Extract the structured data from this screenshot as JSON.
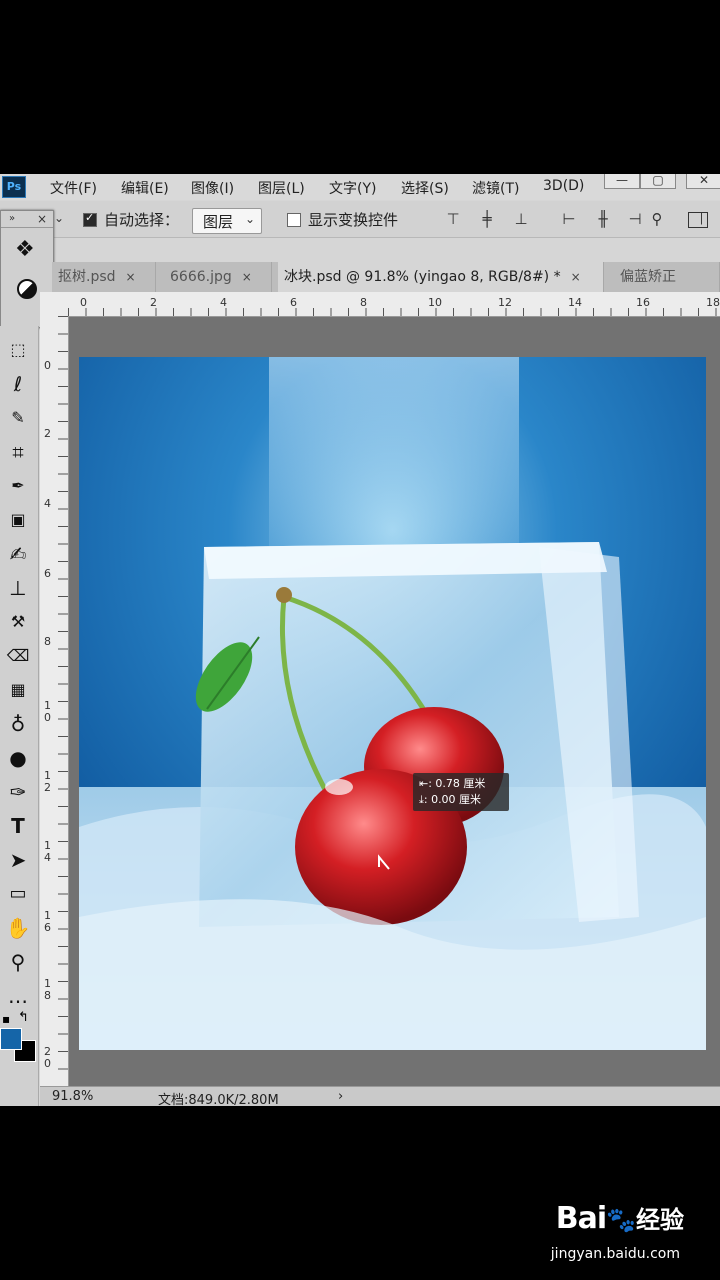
{
  "app": {
    "logo": "Ps",
    "menu": [
      "文件(F)",
      "编辑(E)",
      "图像(I)",
      "图层(L)",
      "文字(Y)",
      "选择(S)",
      "滤镜(T)",
      "3D(D)"
    ],
    "window_buttons": [
      "—",
      "▢",
      "✕"
    ]
  },
  "options": {
    "auto_select_label": "自动选择：",
    "auto_select_checked": true,
    "auto_select_value": "图层",
    "show_transform_label": "显示变换控件",
    "show_transform_checked": false
  },
  "tabs": [
    {
      "label": "抠树.psd",
      "close": "×",
      "active": false
    },
    {
      "label": "6666.jpg",
      "close": "×",
      "active": false
    },
    {
      "label": "冰块.psd @ 91.8% (yingao 8, RGB/8#) *",
      "close": "×",
      "active": true
    },
    {
      "label": "偏蓝矫正",
      "close": "",
      "active": false
    }
  ],
  "ruler": {
    "h_ticks": [
      "0",
      "2",
      "4",
      "6",
      "8",
      "10",
      "12",
      "14",
      "16",
      "18"
    ],
    "v_ticks": [
      "0",
      "2",
      "4",
      "6",
      "8",
      "1 0",
      "1 2",
      "1 4",
      "1 6",
      "1 8",
      "2 0"
    ]
  },
  "tooltip": {
    "line1": "⇤: 0.78 厘米",
    "line2": "⤓: 0.00 厘米"
  },
  "status": {
    "zoom": "91.8%",
    "doc": "文档:849.0K/2.80M",
    "arrow": "›"
  },
  "watermark": {
    "brand": "Bai",
    "brand2": "经验",
    "url": "jingyan.baidu.com"
  },
  "colors": {
    "foreground": "#1565a8",
    "background": "#000000",
    "artwork_bg": "#1e6fb8"
  }
}
